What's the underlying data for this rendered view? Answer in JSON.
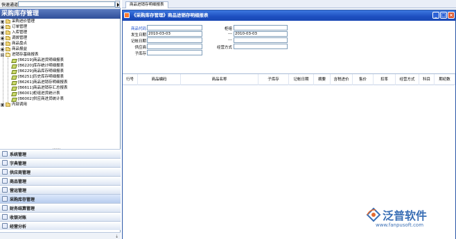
{
  "quick_nav": {
    "label": "快速通道"
  },
  "app": {
    "title": "采购库存管理"
  },
  "tree": {
    "items": [
      {
        "label": "采购进价管理",
        "type": "folder"
      },
      {
        "label": "订单管理",
        "type": "folder"
      },
      {
        "label": "入库管理",
        "type": "folder"
      },
      {
        "label": "调拨管理",
        "type": "folder"
      },
      {
        "label": "商品盘点",
        "type": "folder"
      },
      {
        "label": "商品报益",
        "type": "folder"
      },
      {
        "label": "进销存基础报表",
        "type": "folder-open"
      },
      {
        "label": "[B6219]商品进货明细报表",
        "type": "doc"
      },
      {
        "label": "[B6220]库存统计明细报表",
        "type": "doc"
      },
      {
        "label": "[B6229]商品库存明细报表",
        "type": "doc"
      },
      {
        "label": "[B6251]历史库存明细报表",
        "type": "doc"
      },
      {
        "label": "[B6261]商品进销存明细报表",
        "type": "doc"
      },
      {
        "label": "[B6611]商品进销存汇总报表",
        "type": "doc"
      },
      {
        "label": "[B6001]柜组进货统计表",
        "type": "doc"
      },
      {
        "label": "[B6002]供应商进货统计表",
        "type": "doc"
      },
      {
        "label": "内部调用",
        "type": "folder"
      }
    ]
  },
  "nav": {
    "items": [
      {
        "label": "系统管理",
        "icon": "system-icon"
      },
      {
        "label": "字典管理",
        "icon": "dictionary-icon"
      },
      {
        "label": "供应商管理",
        "icon": "supplier-icon"
      },
      {
        "label": "商品管理",
        "icon": "goods-icon"
      },
      {
        "label": "营运管理",
        "icon": "operation-icon"
      },
      {
        "label": "采购库存管理",
        "icon": "purchase-icon",
        "active": true
      },
      {
        "label": "财务结算管理",
        "icon": "finance-icon"
      },
      {
        "label": "收银对账",
        "icon": "cashier-icon"
      },
      {
        "label": "经营分析",
        "icon": "analysis-icon"
      }
    ]
  },
  "tab": {
    "label": "商品进销存明细报表"
  },
  "window": {
    "title": "《采购库存管理》商品进销存明细报表"
  },
  "form": {
    "product_code_label": "商品代码",
    "start_date_label": "发生日期",
    "start_date_value": "2010-03-03",
    "book_date_label": "记帐日期",
    "supplier_label": "供应商",
    "sub_warehouse_label": "子库存",
    "counter_label": "柜组",
    "end_date_sep": "---",
    "end_date_value": "2010-03-03",
    "book_date_sep": "---",
    "business_mode_label": "经营方式"
  },
  "grid": {
    "columns": [
      "行号",
      "商品编码",
      "商品名称",
      "子库存",
      "记帐日期",
      "摘要",
      "含税进价",
      "售价",
      "扣率",
      "经营方式",
      "科目",
      "期初数"
    ]
  },
  "logo": {
    "text": "泛普软件",
    "url": "www.fanpusoft.com"
  },
  "colors": {
    "title_bar": "#1d4fc0",
    "accent_blue": "#1b4fcc",
    "logo": "#3a6fb5"
  }
}
